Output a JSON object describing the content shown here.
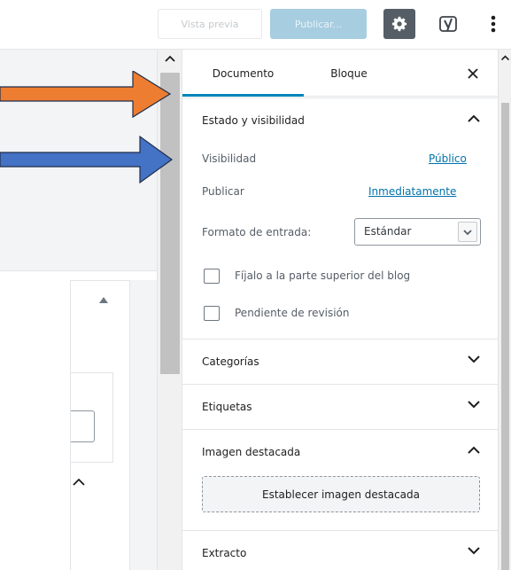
{
  "toolbar": {
    "preview_label": "Vista previa",
    "publish_label": "Publicar...",
    "settings_icon": "gear-icon",
    "yoast_icon": "yoast-icon",
    "more_icon": "more-vertical-icon"
  },
  "sidebar": {
    "tabs": [
      {
        "label": "Documento",
        "active": true
      },
      {
        "label": "Bloque",
        "active": false
      }
    ],
    "close_icon": "close-icon",
    "status": {
      "title": "Estado y visibilidad",
      "visibility_label": "Visibilidad",
      "visibility_value": "Público",
      "publish_label": "Publicar",
      "publish_value": "Inmediatamente",
      "format_label": "Formato de entrada:",
      "format_value": "Estándar",
      "sticky_label": "Fíjalo a la parte superior del blog",
      "pending_label": "Pendiente de revisión"
    },
    "sections": {
      "categories": "Categorías",
      "tags": "Etiquetas",
      "featured_image": "Imagen destacada",
      "featured_button": "Establecer imagen destacada",
      "excerpt": "Extracto"
    }
  },
  "colors": {
    "accent": "#0085ba",
    "link": "#0073aa",
    "publish_disabled": "#a7cde0",
    "settings_active": "#555d66",
    "annotation_orange": "#ed7d31",
    "annotation_blue": "#4472c4"
  }
}
